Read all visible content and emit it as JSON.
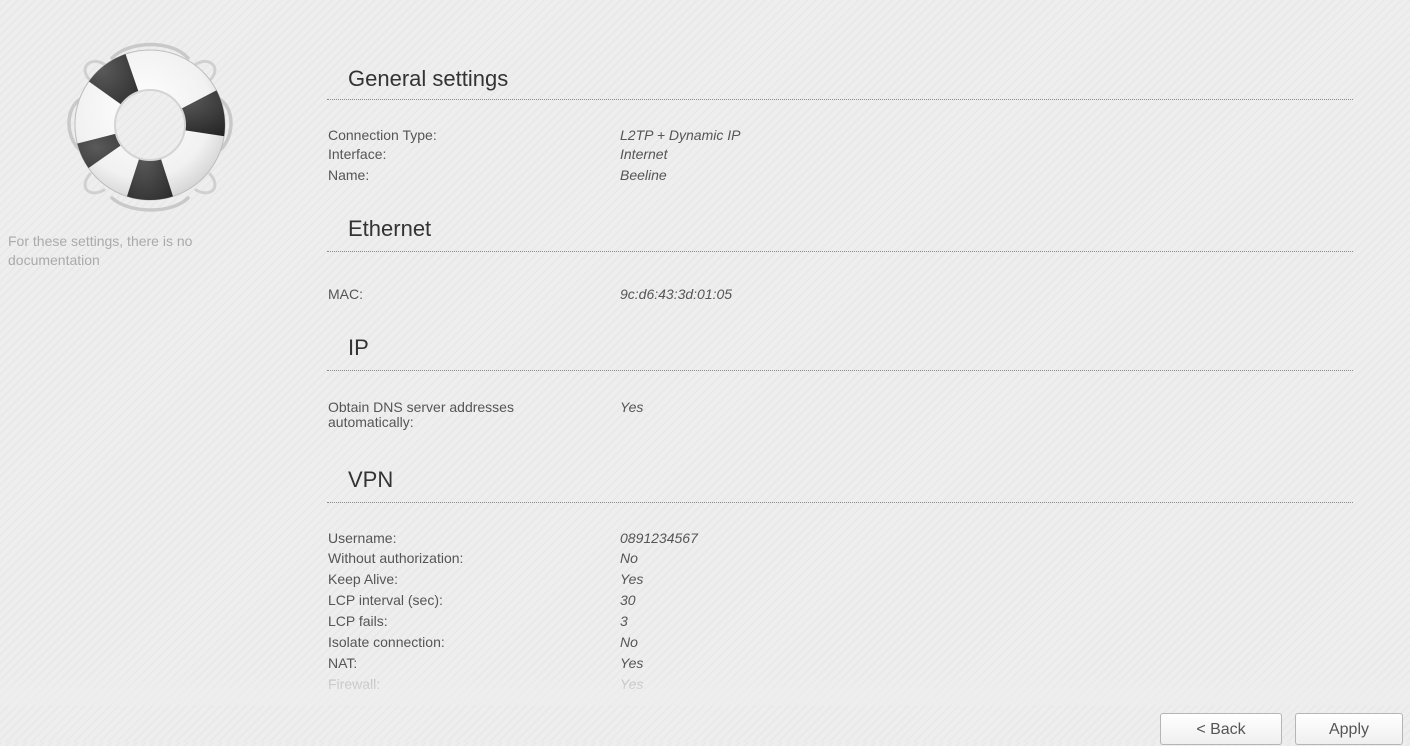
{
  "help": {
    "icon": "lifebuoy-icon",
    "text": "For these settings, there is no documentation"
  },
  "sections": {
    "general": {
      "title": "General settings",
      "rows": [
        {
          "label": "Connection Type:",
          "value": "L2TP + Dynamic IP"
        },
        {
          "label": "Interface:",
          "value": "Internet"
        },
        {
          "label": "Name:",
          "value": "Beeline"
        }
      ]
    },
    "ethernet": {
      "title": "Ethernet",
      "rows": [
        {
          "label": "MAC:",
          "value": "9c:d6:43:3d:01:05"
        }
      ]
    },
    "ip": {
      "title": "IP",
      "rows": [
        {
          "label": "Obtain DNS server addresses automatically:",
          "value": "Yes"
        }
      ]
    },
    "vpn": {
      "title": "VPN",
      "rows": [
        {
          "label": "Username:",
          "value": "0891234567"
        },
        {
          "label": "Without authorization:",
          "value": "No"
        },
        {
          "label": "Keep Alive:",
          "value": "Yes"
        },
        {
          "label": "LCP interval (sec):",
          "value": "30"
        },
        {
          "label": "LCP fails:",
          "value": "3"
        },
        {
          "label": "Isolate connection:",
          "value": "No"
        },
        {
          "label": "NAT:",
          "value": "Yes"
        },
        {
          "label": "Firewall:",
          "value": "Yes"
        }
      ]
    }
  },
  "buttons": {
    "back_label": "< Back",
    "apply_label": "Apply"
  },
  "colors": {
    "background": "#eeeeee",
    "heading": "#333333",
    "text": "#555555",
    "help_text": "#aaaaaa",
    "lifebuoy_red": "#2a2a2a"
  }
}
